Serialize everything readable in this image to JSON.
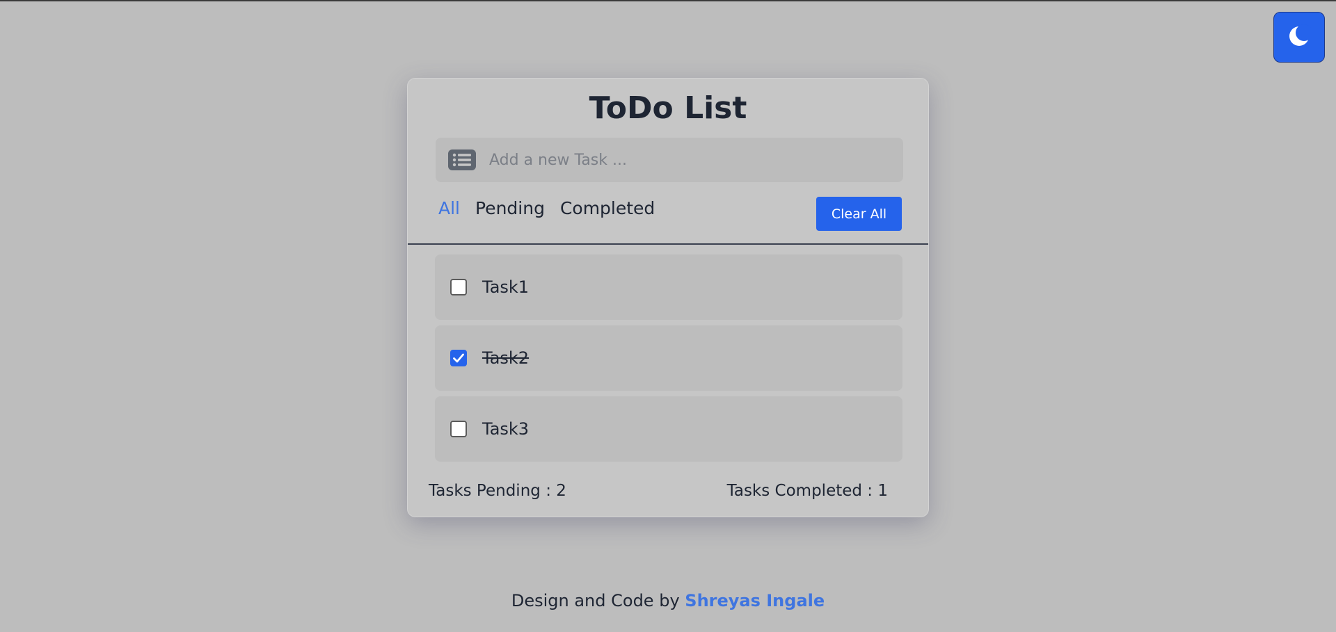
{
  "theme_toggle": {
    "icon": "moon-icon"
  },
  "card": {
    "title": "ToDo List",
    "input": {
      "placeholder": "Add a new Task ...",
      "value": "",
      "icon": "list-icon"
    },
    "filters": [
      {
        "label": "All",
        "active": true
      },
      {
        "label": "Pending",
        "active": false
      },
      {
        "label": "Completed",
        "active": false
      }
    ],
    "clear_all_label": "Clear All",
    "tasks": [
      {
        "label": "Task1",
        "completed": false
      },
      {
        "label": "Task2",
        "completed": true
      },
      {
        "label": "Task3",
        "completed": false
      }
    ],
    "stats": {
      "pending": "Tasks Pending : 2",
      "completed": "Tasks Completed : 1"
    }
  },
  "footer": {
    "prefix": "Design and Code by",
    "author": "Shreyas Ingale"
  },
  "colors": {
    "accent": "#2563eb",
    "active_filter": "#3f75e0",
    "background": "#bdbdbd",
    "card": "#c6c6c6",
    "text": "#1e2533"
  }
}
